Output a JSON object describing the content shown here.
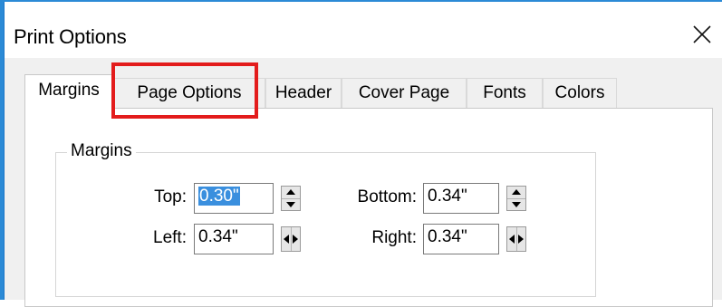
{
  "window": {
    "title": "Print Options",
    "close_glyph": "✕"
  },
  "tabs": [
    {
      "label": "Margins",
      "active": true
    },
    {
      "label": "Page Options",
      "active": false
    },
    {
      "label": "Header",
      "active": false
    },
    {
      "label": "Cover Page",
      "active": false
    },
    {
      "label": "Fonts",
      "active": false
    },
    {
      "label": "Colors",
      "active": false
    }
  ],
  "margins_group": {
    "label": "Margins",
    "top": {
      "label": "Top:",
      "value": "0.30\""
    },
    "bottom": {
      "label": "Bottom:",
      "value": "0.34\""
    },
    "left": {
      "label": "Left:",
      "value": "0.34\""
    },
    "right": {
      "label": "Right:",
      "value": "0.34\""
    }
  },
  "colors": {
    "accent": "#2b8ad6",
    "highlight": "#e31c1c",
    "selection": "#3a8fde"
  },
  "icons": {
    "close": "close-icon",
    "spin_up": "triangle-up-icon",
    "spin_down": "triangle-down-icon",
    "spin_left": "triangle-left-icon",
    "spin_right": "triangle-right-icon"
  }
}
